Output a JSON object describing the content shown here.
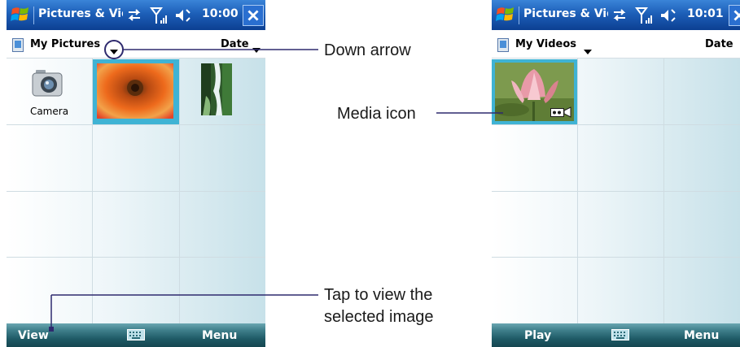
{
  "left_screen": {
    "app_title": "Pictures & Vid",
    "clock": "10:00",
    "folder": "My Pictures",
    "sort": "Date",
    "thumbnails": [
      {
        "label": "Camera",
        "icon": "camera-icon"
      },
      {
        "label": "",
        "icon": "flower-photo",
        "selected": true
      },
      {
        "label": "",
        "icon": "waterfall-photo"
      }
    ],
    "softkeys": {
      "left": "View",
      "right": "Menu"
    }
  },
  "right_screen": {
    "app_title": "Pictures & Vid",
    "clock": "10:01",
    "folder": "My Videos",
    "sort": "Date",
    "thumbnails": [
      {
        "label": "",
        "icon": "lotus-video",
        "selected": true,
        "badge": "video-camera-icon"
      }
    ],
    "softkeys": {
      "left": "Play",
      "right": "Menu"
    }
  },
  "callouts": {
    "down_arrow": "Down arrow",
    "media_icon": "Media icon",
    "tap_line1": "Tap to view the",
    "tap_line2": "selected image"
  },
  "colors": {
    "titlebar": "#1d5fb8",
    "softbar": "#2a6a76",
    "selection": "#3fb3d4",
    "callout_line": "#2e2a6e"
  }
}
